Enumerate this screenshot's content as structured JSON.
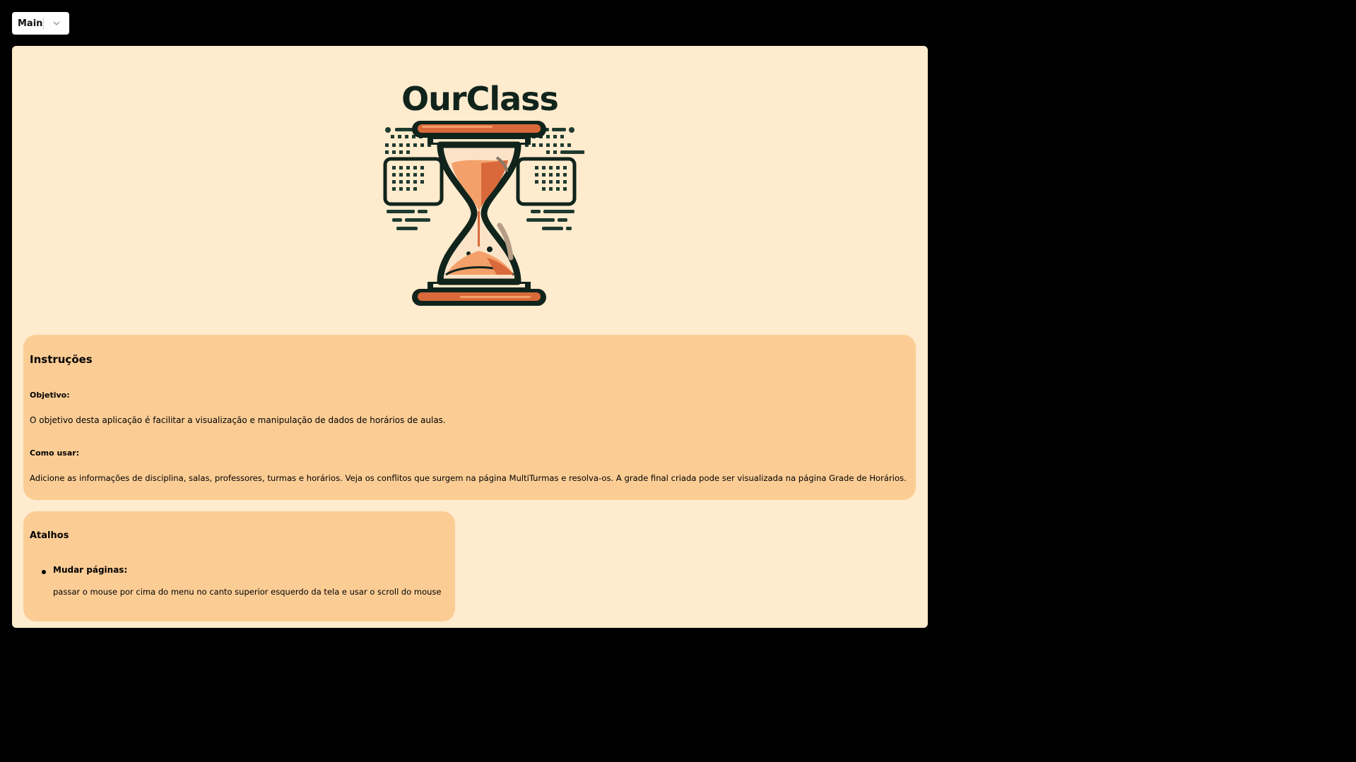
{
  "page_selector": {
    "label": "Main",
    "icon": "chevron-down-icon"
  },
  "logo": {
    "title": "OurClass",
    "icon": "hourglass-icon"
  },
  "instructions": {
    "title": "Instruções",
    "objective_heading": "Objetivo:",
    "objective_text": "O objetivo desta aplicação é facilitar a visualização e manipulação de dados de horários de aulas.",
    "howto_heading": "Como usar:",
    "howto_text": "Adicione as informações de disciplina, salas, professores, turmas e horários. Veja os conflitos que surgem na página MultiTurmas e resolva-os. A grade final criada pode ser visualizada na página Grade de Horários."
  },
  "shortcuts": {
    "title": "Atalhos",
    "items": [
      {
        "title": "Mudar páginas:",
        "text": "passar o mouse por cima do menu no canto superior esquerdo da tela e usar o scroll do mouse"
      }
    ]
  },
  "colors": {
    "background": "#000000",
    "panel": "#ffebcd",
    "card": "#fbcd95",
    "logo_dark": "#10241c",
    "logo_accent": "#d9693a",
    "logo_sand": "#f4a06a"
  }
}
